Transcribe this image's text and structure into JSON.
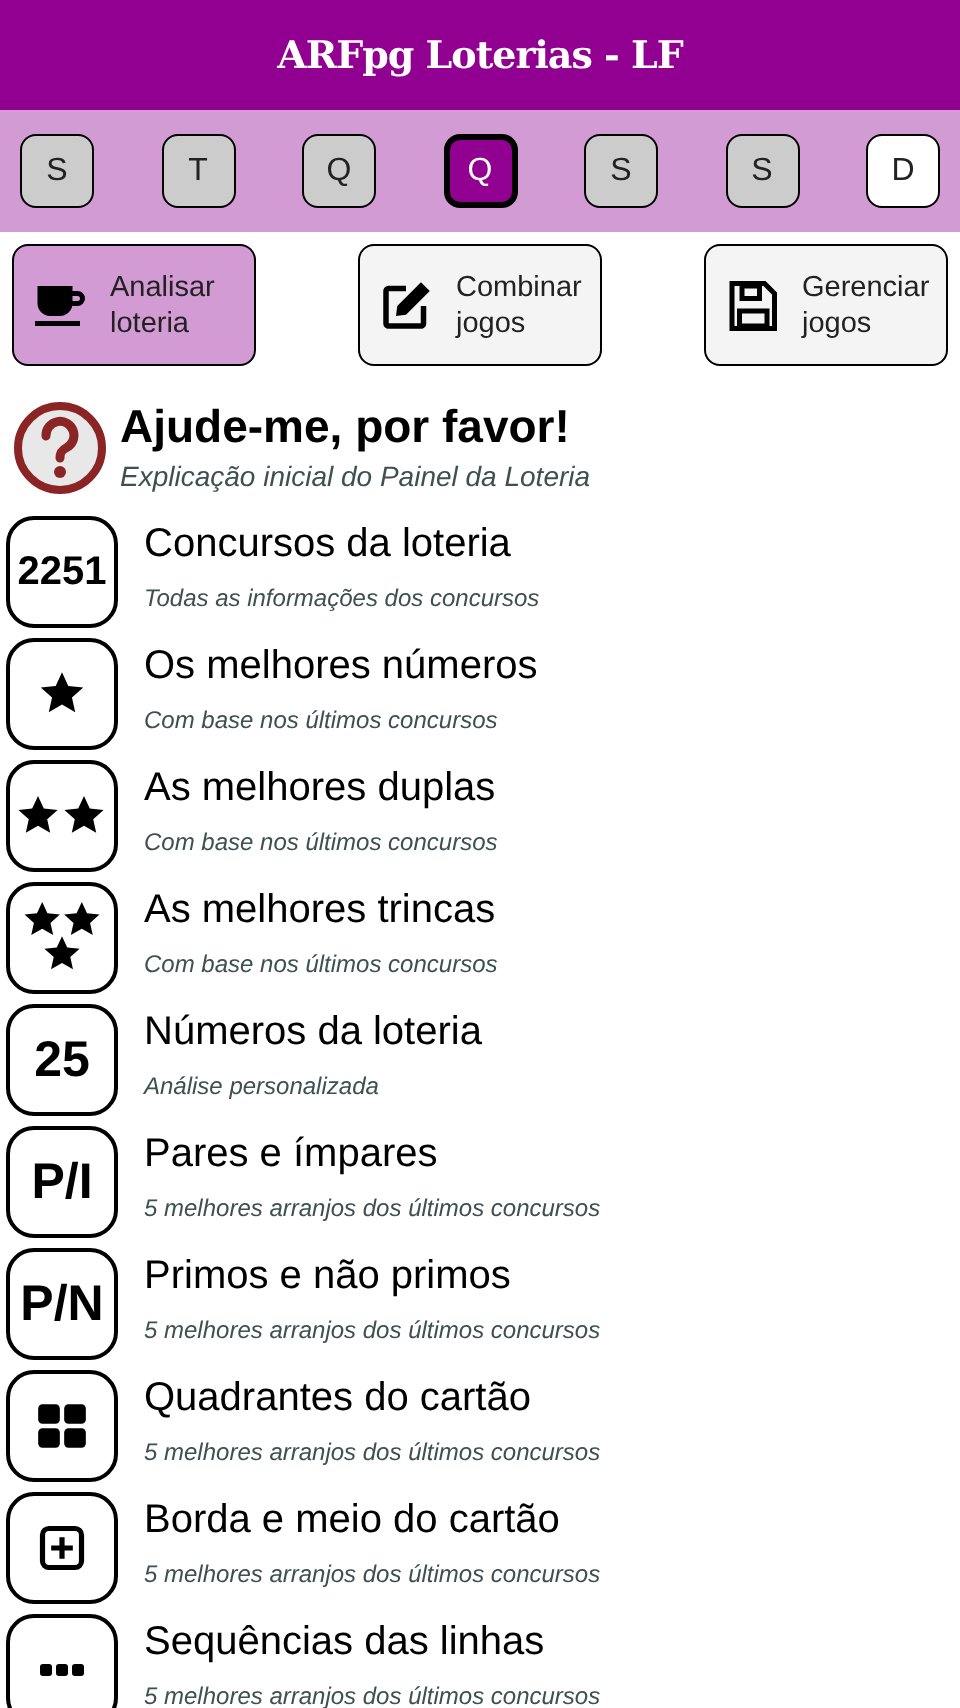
{
  "app_bar": {
    "title": "ARFpg Loterias - LF"
  },
  "days": [
    {
      "label": "S",
      "selected": false,
      "draw_day": true
    },
    {
      "label": "T",
      "selected": false,
      "draw_day": true
    },
    {
      "label": "Q",
      "selected": false,
      "draw_day": true
    },
    {
      "label": "Q",
      "selected": true,
      "draw_day": true
    },
    {
      "label": "S",
      "selected": false,
      "draw_day": true
    },
    {
      "label": "S",
      "selected": false,
      "draw_day": true
    },
    {
      "label": "D",
      "selected": false,
      "draw_day": false
    }
  ],
  "actions": [
    {
      "kind": "cup",
      "label": "Analisar loteria",
      "selected": true
    },
    {
      "kind": "edit",
      "label": "Combinar jogos",
      "selected": false
    },
    {
      "kind": "save",
      "label": "Gerenciar jogos",
      "selected": false
    }
  ],
  "menu": [
    {
      "kind": "help",
      "title": "Ajude-me, por favor!",
      "subtitle": "Explicação inicial do Painel da Loteria"
    },
    {
      "kind": "text",
      "badge": "2251",
      "title": "Concursos da loteria",
      "subtitle": "Todas as informações dos concursos"
    },
    {
      "kind": "star1",
      "title": "Os melhores números",
      "subtitle": "Com base nos últimos concursos"
    },
    {
      "kind": "star2",
      "title": "As melhores duplas",
      "subtitle": "Com base nos últimos concursos"
    },
    {
      "kind": "star3",
      "title": "As melhores trincas",
      "subtitle": "Com base nos últimos concursos"
    },
    {
      "kind": "text",
      "badge": "25",
      "title": "Números da loteria",
      "subtitle": "Análise personalizada"
    },
    {
      "kind": "text",
      "badge": "P/I",
      "title": "Pares e ímpares",
      "subtitle": "5 melhores arranjos dos últimos concursos"
    },
    {
      "kind": "text",
      "badge": "P/N",
      "title": "Primos e não primos",
      "subtitle": "5 melhores arranjos dos últimos concursos"
    },
    {
      "kind": "grid",
      "title": "Quadrantes do cartão",
      "subtitle": "5 melhores arranjos dos últimos concursos"
    },
    {
      "kind": "plus",
      "title": "Borda e meio do cartão",
      "subtitle": "5 melhores arranjos dos últimos concursos"
    },
    {
      "kind": "dots",
      "title": "Sequências das linhas",
      "subtitle": "5 melhores arranjos dos últimos concursos"
    }
  ]
}
